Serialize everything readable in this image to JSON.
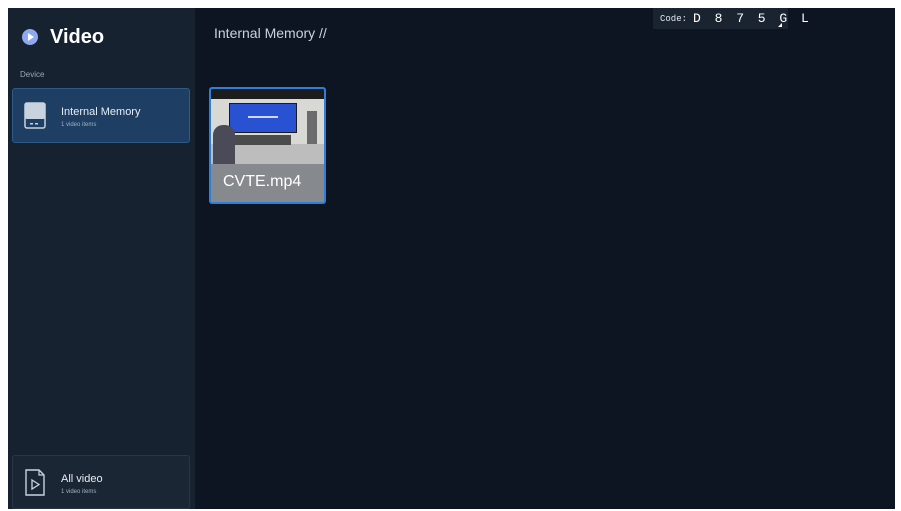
{
  "app": {
    "title": "Video"
  },
  "sidebar": {
    "section_label": "Device",
    "items": [
      {
        "label": "Internal Memory",
        "sublabel": "1 video items",
        "icon": "storage-icon",
        "selected": true
      },
      {
        "label": "All video",
        "sublabel": "1 video items",
        "icon": "video-file-icon",
        "selected": false
      }
    ]
  },
  "breadcrumb": "Internal Memory //",
  "code": {
    "label": "Code:",
    "value": "D 8 7 5 G L"
  },
  "files": [
    {
      "name": "CVTE.mp4",
      "selected": true
    }
  ],
  "colors": {
    "background": "#0c1521",
    "sidebar": "#172231",
    "selected_item": "#1e3f63",
    "accent": "#2f7fd8",
    "brand_icon": "#8fa8f0"
  }
}
